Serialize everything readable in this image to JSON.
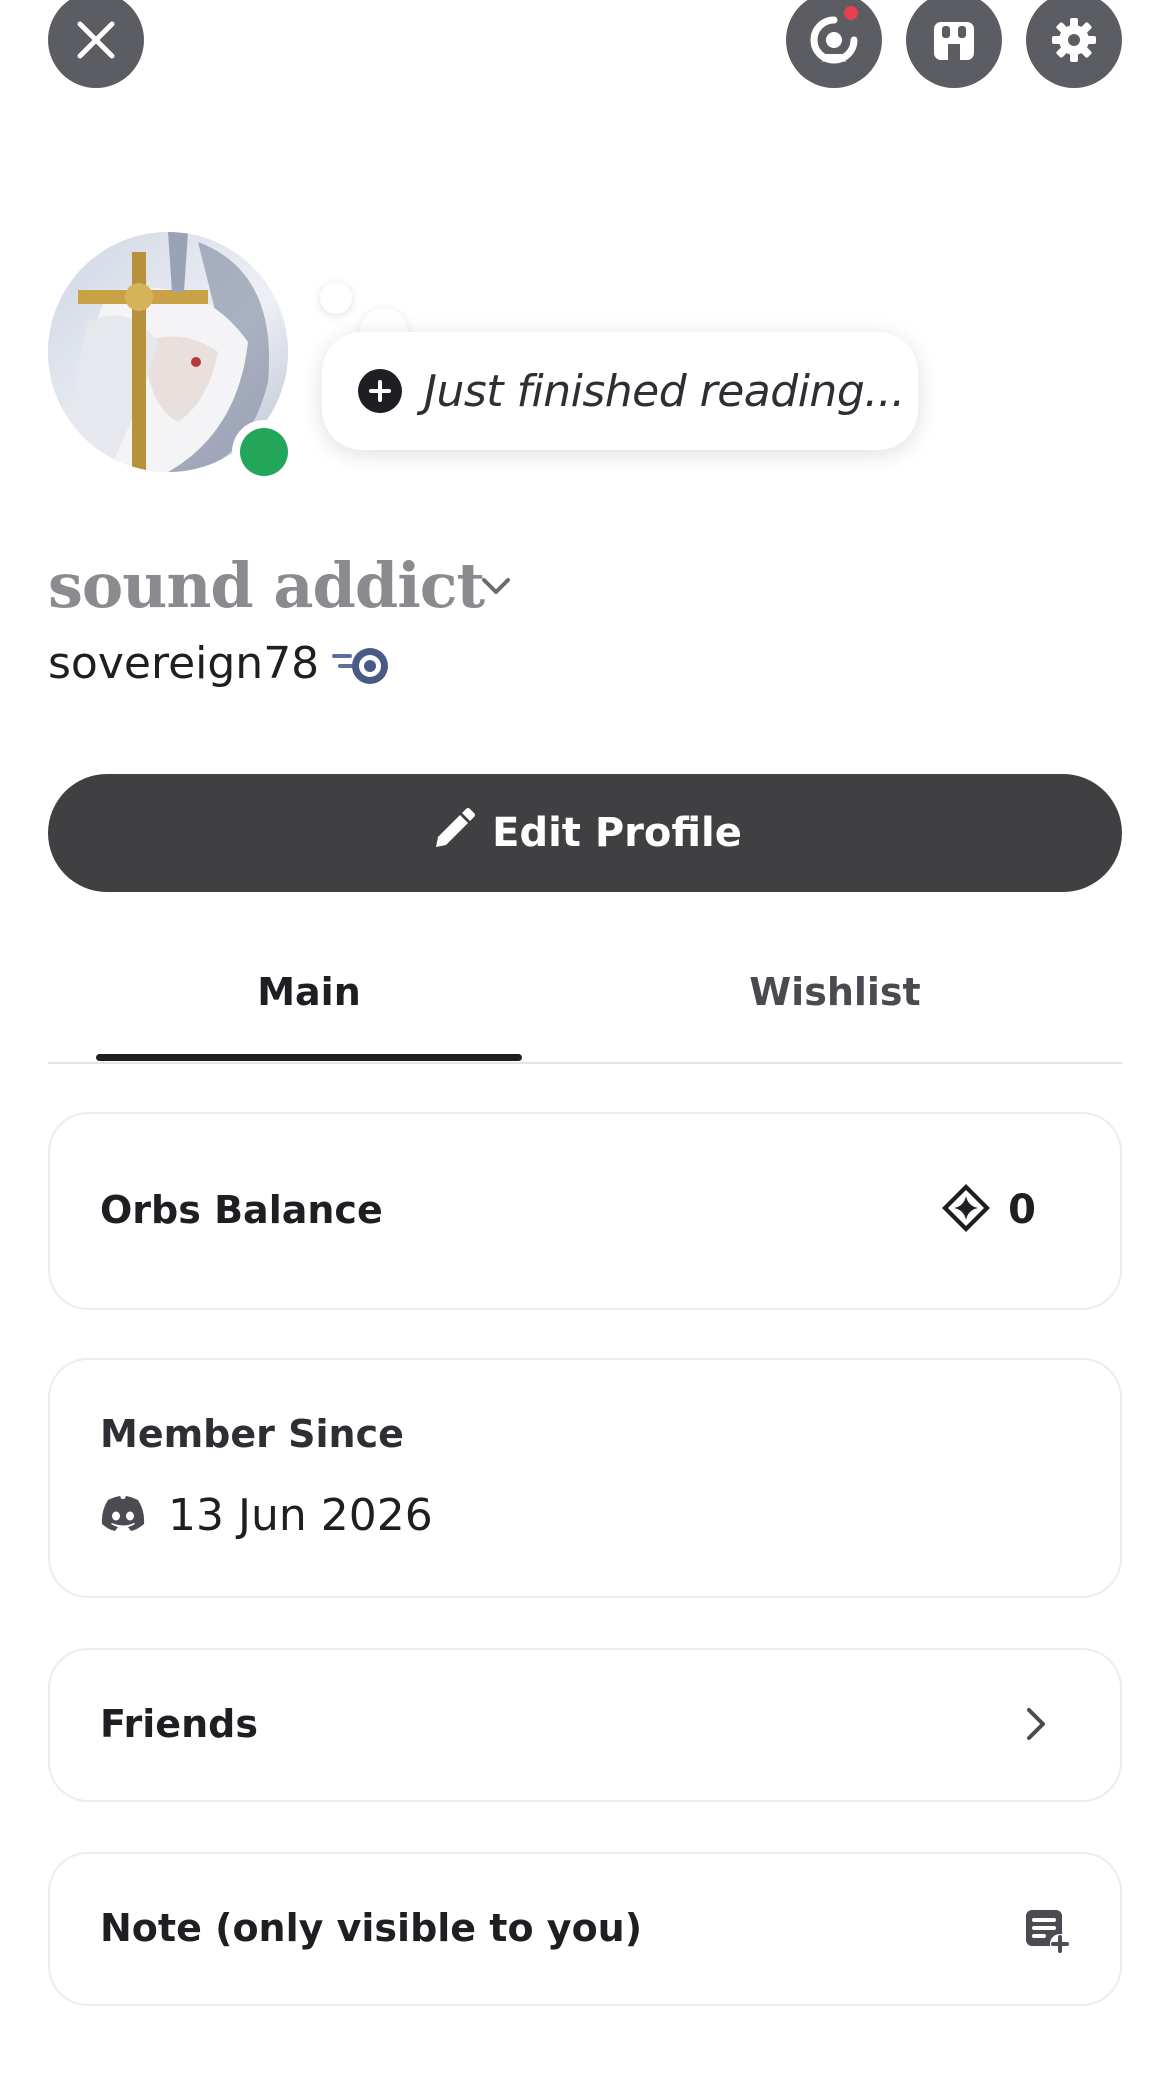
{
  "header": {
    "close_icon": "close-icon",
    "quests_icon": "quests-icon",
    "shop_icon": "shop-icon",
    "settings_icon": "gear-icon"
  },
  "profile": {
    "status_bubble_text": "Just finished reading...",
    "display_name": "sound addict",
    "username": "sovereign78",
    "online_status_color": "#23a55a",
    "edit_button_label": "Edit Profile"
  },
  "tabs": [
    {
      "label": "Main",
      "selected": true
    },
    {
      "label": "Wishlist",
      "selected": false
    }
  ],
  "cards": {
    "orbs": {
      "title": "Orbs Balance",
      "value": "0"
    },
    "member": {
      "title": "Member Since",
      "date": "13 Jun 2026"
    },
    "friends": {
      "title": "Friends"
    },
    "note": {
      "title": "Note (only visible to you)"
    }
  },
  "colors": {
    "button_dark": "#404043",
    "icon_button_bg": "#5c5d62",
    "notification_dot": "#e8404a",
    "text_primary": "#1f1f23",
    "display_name": "#8b8b8f"
  }
}
